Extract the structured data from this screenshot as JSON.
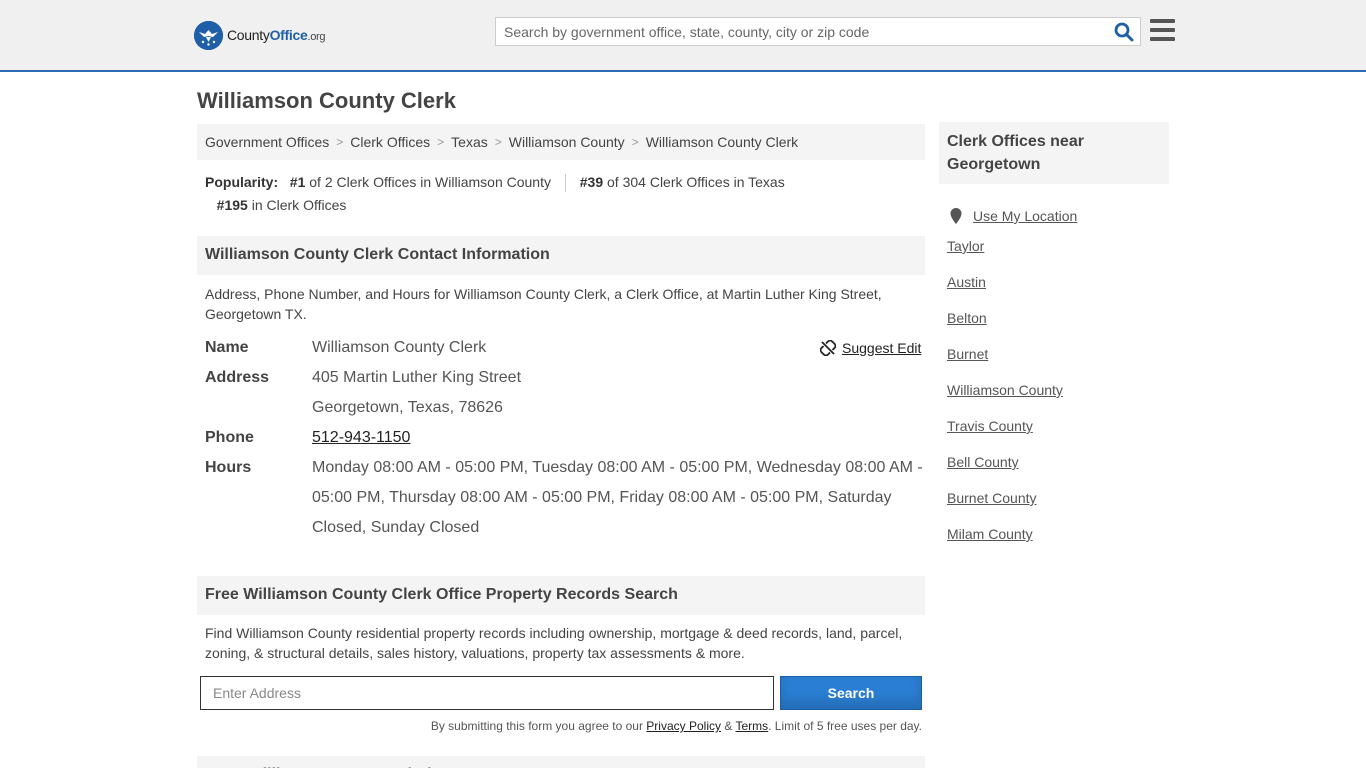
{
  "header": {
    "logo_main": "County",
    "logo_accent": "Office",
    "logo_tld": ".org",
    "search_placeholder": "Search by government office, state, county, city or zip code"
  },
  "page_title": "Williamson County Clerk",
  "breadcrumb": [
    "Government Offices",
    "Clerk Offices",
    "Texas",
    "Williamson County",
    "Williamson County Clerk"
  ],
  "popularity": {
    "label": "Popularity:",
    "rank1": "#1",
    "rank1_text": "of 2 Clerk Offices in Williamson County",
    "rank2": "#39",
    "rank2_text": "of 304 Clerk Offices in Texas",
    "rank3": "#195",
    "rank3_text": "in Clerk Offices"
  },
  "contact": {
    "heading": "Williamson County Clerk Contact Information",
    "description": "Address, Phone Number, and Hours for Williamson County Clerk, a Clerk Office, at Martin Luther King Street, Georgetown TX.",
    "suggest_edit": "Suggest Edit",
    "name_label": "Name",
    "name": "Williamson County Clerk",
    "address_label": "Address",
    "address_line1": "405 Martin Luther King Street",
    "address_line2": "Georgetown, Texas, 78626",
    "phone_label": "Phone",
    "phone": "512-943-1150",
    "hours_label": "Hours",
    "hours": "Monday 08:00 AM - 05:00 PM, Tuesday 08:00 AM - 05:00 PM, Wednesday 08:00 AM - 05:00 PM, Thursday 08:00 AM - 05:00 PM, Friday 08:00 AM - 05:00 PM, Saturday Closed, Sunday Closed"
  },
  "property": {
    "heading": "Free Williamson County Clerk Office Property Records Search",
    "description": "Find Williamson County residential property records including ownership, mortgage & deed records, land, parcel, zoning, & structural details, sales history, valuations, property tax assessments & more.",
    "address_placeholder": "Enter Address",
    "search_label": "Search",
    "terms_prefix": "By submitting this form you agree to our",
    "privacy_policy": "Privacy Policy",
    "amp": "&",
    "terms": "Terms",
    "terms_suffix": ". Limit of 5 free uses per day."
  },
  "more_heading": "More Williamson County Clerk",
  "sidebar": {
    "heading": "Clerk Offices near Georgetown",
    "use_location": "Use My Location",
    "links": [
      "Taylor",
      "Austin",
      "Belton",
      "Burnet",
      "Williamson County",
      "Travis County",
      "Bell County",
      "Burnet County",
      "Milam County"
    ]
  },
  "colors": {
    "brand_blue": "#1e5fa8",
    "button_blue": "#2a7fd4",
    "header_bg": "#f0f0f0"
  }
}
